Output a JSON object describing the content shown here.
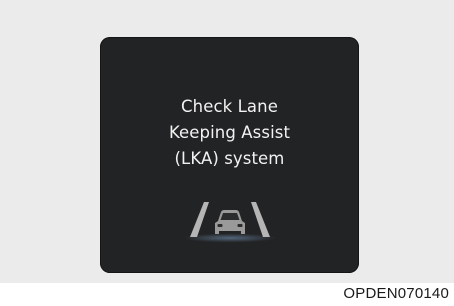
{
  "display": {
    "message_lines": [
      "Check Lane",
      "Keeping Assist",
      "(LKA) system"
    ],
    "icon": "lane-keeping-car-icon",
    "colors": {
      "background": "#ebebeb",
      "panel": "#222324",
      "text": "#f2f2f2",
      "icon_grey": "#9a9a9a",
      "glow": "#7a9cc0"
    }
  },
  "caption": {
    "image_code": "OPDEN070140"
  }
}
